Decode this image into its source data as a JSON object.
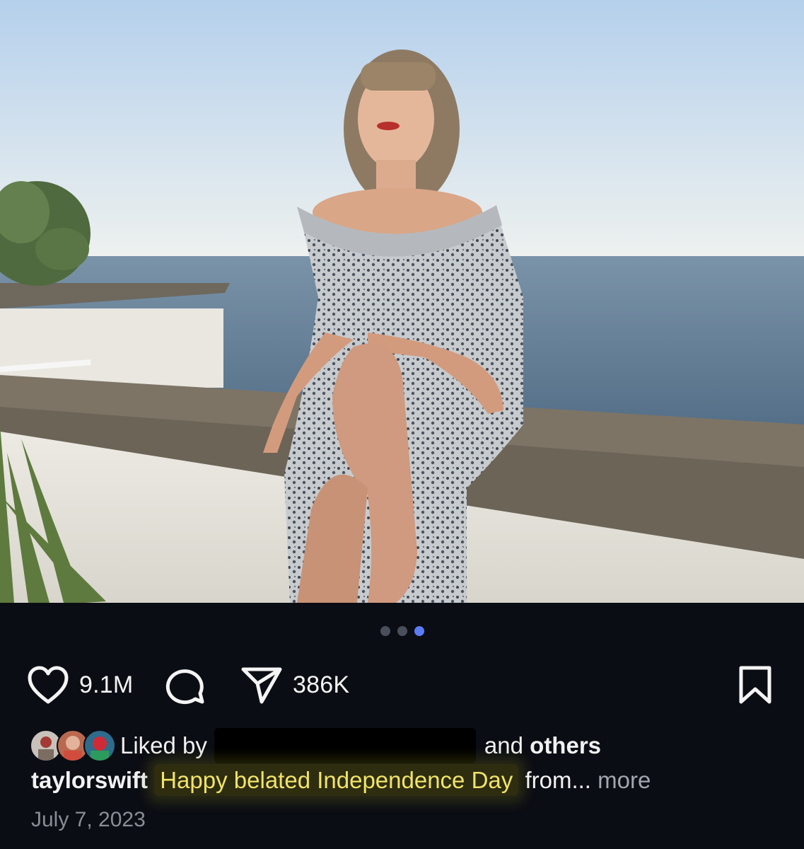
{
  "post": {
    "image": {
      "description": "photo",
      "colors": {
        "sky_top": "#b7d2ee",
        "sky_horizon": "#eff1ef",
        "sea": "#5b7791",
        "wall": "#f2f1ec",
        "ledge": "#756d60"
      }
    },
    "carousel": {
      "count": 3,
      "active_index": 2
    },
    "actions": {
      "like": {
        "icon": "heart-icon",
        "count": "9.1M"
      },
      "comment": {
        "icon": "comment-bubble-icon"
      },
      "share": {
        "icon": "paper-plane-icon",
        "count": "386K"
      },
      "save": {
        "icon": "bookmark-icon"
      }
    },
    "liked_by": {
      "prefix": "Liked by",
      "conjunction": "and",
      "others": "others"
    },
    "caption": {
      "username": "taylorswift",
      "text": "Happy belated Independence Day",
      "tail": "from...",
      "more": "more"
    },
    "date": "July 7, 2023"
  },
  "theme": {
    "background": "#0b0d14",
    "dot_active": "#5b7cf7",
    "highlight_text": "#f0e36a"
  }
}
